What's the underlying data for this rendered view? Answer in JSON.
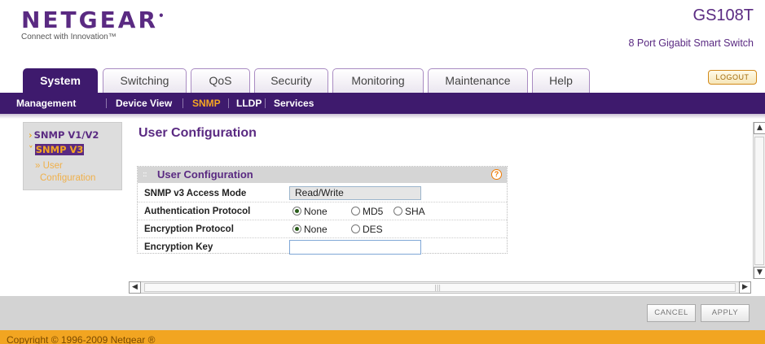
{
  "header": {
    "logo": "NETGEAR",
    "tagline": "Connect with Innovation™",
    "model": "GS108T",
    "model_desc": "8 Port Gigabit Smart Switch",
    "logout": "LOGOUT"
  },
  "tabs": [
    {
      "label": "System",
      "active": true
    },
    {
      "label": "Switching"
    },
    {
      "label": "QoS"
    },
    {
      "label": "Security"
    },
    {
      "label": "Monitoring"
    },
    {
      "label": "Maintenance"
    },
    {
      "label": "Help"
    }
  ],
  "subnav": [
    {
      "label": "Management"
    },
    {
      "label": "Device View"
    },
    {
      "label": "SNMP",
      "active": true
    },
    {
      "label": "LLDP"
    },
    {
      "label": "Services"
    }
  ],
  "leftnav": {
    "v1v2": "SNMP V1/V2",
    "v3": "SNMP V3",
    "sub_line1": "» User",
    "sub_line2": "Configuration"
  },
  "main": {
    "page_title": "User Configuration",
    "panel_title": "User Configuration",
    "help": "?",
    "rows": {
      "access_mode_label": "SNMP v3 Access Mode",
      "access_mode_value": "Read/Write",
      "auth_label": "Authentication Protocol",
      "auth_options": [
        "None",
        "MD5",
        "SHA"
      ],
      "auth_selected": "None",
      "enc_label": "Encryption Protocol",
      "enc_options": [
        "None",
        "DES"
      ],
      "enc_selected": "None",
      "key_label": "Encryption Key",
      "key_value": ""
    }
  },
  "buttons": {
    "cancel": "CANCEL",
    "apply": "APPLY"
  },
  "footer": {
    "copyright": "Copyright © 1996-2009 Netgear ®"
  },
  "colors": {
    "brand": "#5a2a82",
    "nav": "#3e1a6d",
    "accent": "#f2a521"
  }
}
